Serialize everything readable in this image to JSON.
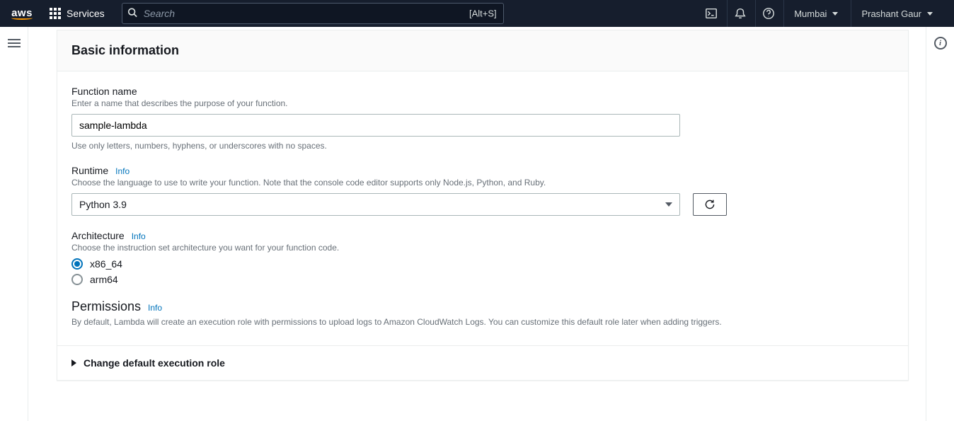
{
  "nav": {
    "brand": "aws",
    "services_label": "Services",
    "search_placeholder": "Search",
    "search_hint": "[Alt+S]",
    "region": "Mumbai",
    "user": "Prashant Gaur"
  },
  "panel": {
    "title": "Basic information",
    "function_name": {
      "label": "Function name",
      "help": "Enter a name that describes the purpose of your function.",
      "value": "sample-lambda",
      "hint": "Use only letters, numbers, hyphens, or underscores with no spaces."
    },
    "runtime": {
      "label": "Runtime",
      "info": "Info",
      "help": "Choose the language to use to write your function. Note that the console code editor supports only Node.js, Python, and Ruby.",
      "selected": "Python 3.9"
    },
    "architecture": {
      "label": "Architecture",
      "info": "Info",
      "help": "Choose the instruction set architecture you want for your function code.",
      "options": {
        "x86_64": "x86_64",
        "arm64": "arm64"
      },
      "selected": "x86_64"
    },
    "permissions": {
      "heading": "Permissions",
      "info": "Info",
      "desc": "By default, Lambda will create an execution role with permissions to upload logs to Amazon CloudWatch Logs. You can customize this default role later when adding triggers."
    },
    "expander_label": "Change default execution role"
  }
}
